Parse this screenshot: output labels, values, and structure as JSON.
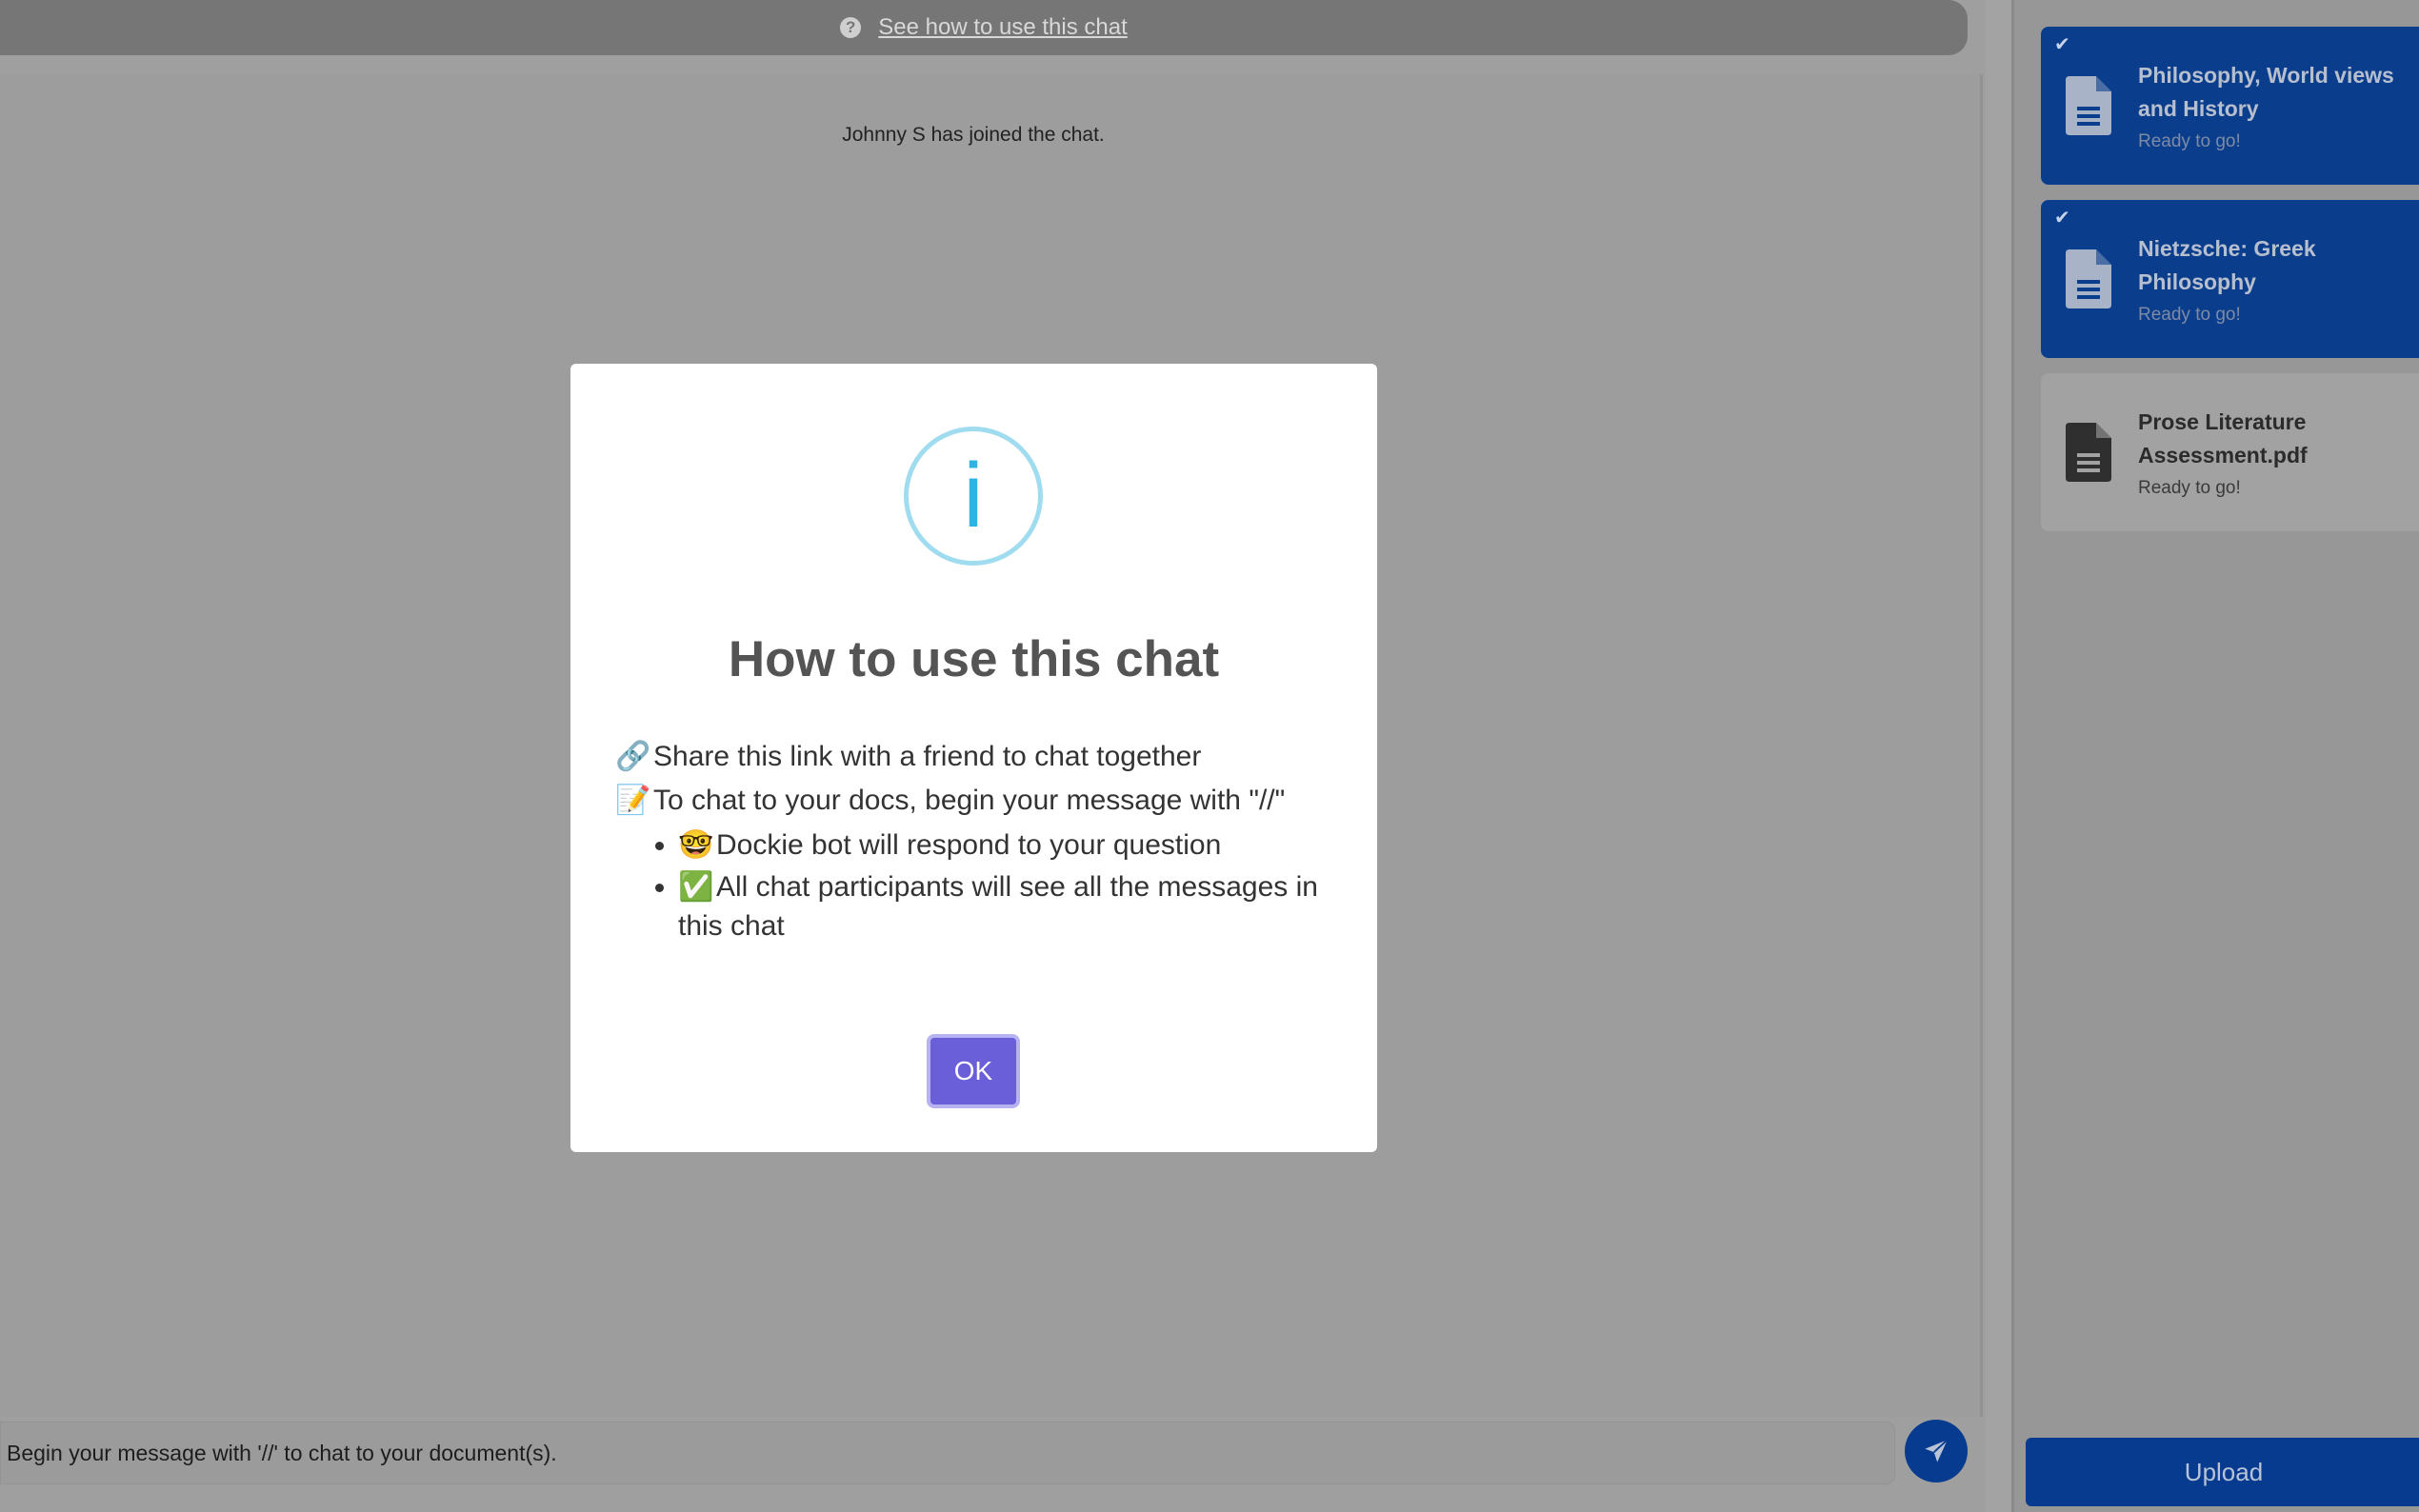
{
  "help_bar": {
    "icon": "question-circle-icon",
    "link_text": "See how to use this chat"
  },
  "chat": {
    "system_message": "Johnny S has joined the chat.",
    "composer_placeholder": "Begin your message with '//' to chat to your document(s).",
    "send_icon": "paper-plane-icon"
  },
  "sidebar": {
    "documents": [
      {
        "title": "Philosophy, World views and History",
        "status": "Ready to go!",
        "selected": true
      },
      {
        "title": "Nietzsche: Greek Philosophy",
        "status": "Ready to go!",
        "selected": true
      },
      {
        "title": "Prose Literature Assessment.pdf",
        "status": "Ready to go!",
        "selected": false
      }
    ],
    "upload_label": "Upload"
  },
  "modal": {
    "icon_glyph": "i",
    "title": "How to use this chat",
    "lines": [
      {
        "emoji": "🔗",
        "text": "Share this link with a friend to chat together"
      },
      {
        "emoji": "📝",
        "text": "To chat to your docs, begin your message with \"//\""
      }
    ],
    "bullets": [
      {
        "emoji": "🤓",
        "text": "Dockie bot will respond to your question"
      },
      {
        "emoji": "✅",
        "text": "All chat participants will see all the messages in this chat"
      }
    ],
    "ok_label": "OK"
  },
  "colors": {
    "accent_blue": "#063b8f",
    "ok_purple": "#6a5ed9",
    "info_cyan": "#2fb3e3"
  }
}
